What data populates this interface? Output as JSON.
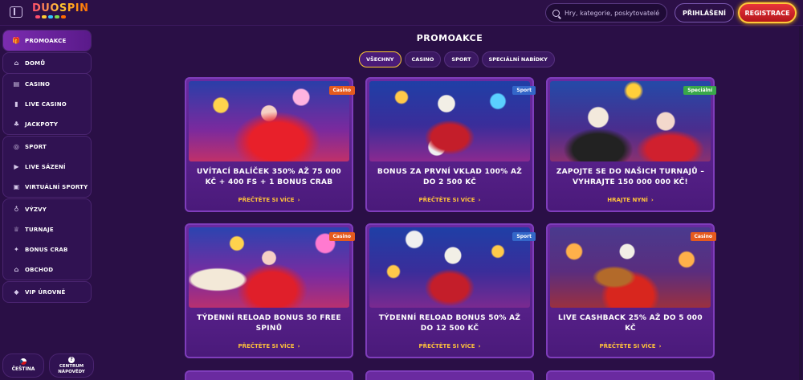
{
  "header": {
    "logo": "DUOSPIN",
    "search_placeholder": "Hry, kategorie, poskytovatelé",
    "login_label": "PŘIHLÁŠENÍ",
    "register_label": "REGISTRACE"
  },
  "sidebar": {
    "groups": [
      [
        {
          "label": "PROMOAKCE",
          "icon": "gift-icon",
          "active": true
        }
      ],
      [
        {
          "label": "DOMŮ",
          "icon": "home-icon"
        }
      ],
      [
        {
          "label": "CASINO",
          "icon": "slot-icon"
        },
        {
          "label": "LIVE CASINO",
          "icon": "live-casino-icon"
        },
        {
          "label": "JACKPOTY",
          "icon": "clover-icon"
        }
      ],
      [
        {
          "label": "SPORT",
          "icon": "ball-icon"
        },
        {
          "label": "LIVE SÁZENÍ",
          "icon": "live-betting-icon"
        },
        {
          "label": "VIRTUÁLNÍ SPORTY",
          "icon": "virtual-sports-icon"
        }
      ],
      [
        {
          "label": "VÝZVY",
          "icon": "target-icon"
        },
        {
          "label": "TURNAJE",
          "icon": "trophy-icon"
        },
        {
          "label": "BONUS CRAB",
          "icon": "crab-icon"
        },
        {
          "label": "OBCHOD",
          "icon": "shop-icon"
        }
      ],
      [
        {
          "label": "VIP ÚROVNĚ",
          "icon": "diamond-icon"
        }
      ]
    ],
    "language_label": "ČEŠTINA",
    "help_label_line1": "CENTRUM",
    "help_label_line2": "NÁPOVĚDY"
  },
  "main": {
    "title": "PROMOAKCE",
    "tabs": [
      "VŠECHNY",
      "CASINO",
      "SPORT",
      "SPECIÁLNÍ NABÍDKY"
    ],
    "active_tab": "VŠECHNY",
    "cards": [
      {
        "badge": "Casino",
        "badge_type": "casino",
        "title": "UVÍTACÍ BALÍČEK 350% AŽ 75 000 KČ + 400 FS + 1 BONUS CRAB",
        "link": "PŘEČTĚTE SI VÍCE"
      },
      {
        "badge": "Sport",
        "badge_type": "sport",
        "title": "BONUS ZA PRVNÍ VKLAD 100% AŽ DO 2 500 KČ",
        "link": "PŘEČTĚTE SI VÍCE"
      },
      {
        "badge": "Speciální",
        "badge_type": "special",
        "title": "ZAPOJTE SE DO NAŠICH TURNAJŮ – VYHRAJTE 150 000 000 KČ!",
        "link": "HRAJTE NYNÍ"
      },
      {
        "badge": "Casino",
        "badge_type": "casino",
        "title": "TÝDENNÍ RELOAD BONUS 50 FREE SPINŮ",
        "link": "PŘEČTĚTE SI VÍCE"
      },
      {
        "badge": "Sport",
        "badge_type": "sport",
        "title": "TÝDENNÍ RELOAD BONUS 50% AŽ DO 12 500 KČ",
        "link": "PŘEČTĚTE SI VÍCE"
      },
      {
        "badge": "Casino",
        "badge_type": "casino",
        "title": "LIVE CASHBACK 25% AŽ DO 5 000 KČ",
        "link": "PŘEČTĚTE SI VÍCE"
      }
    ]
  },
  "colors": {
    "background": "#2a0f46",
    "accent_gold": "#ffc23a",
    "register_red": "#d0262c",
    "card_purple": "#6a2aa0"
  }
}
